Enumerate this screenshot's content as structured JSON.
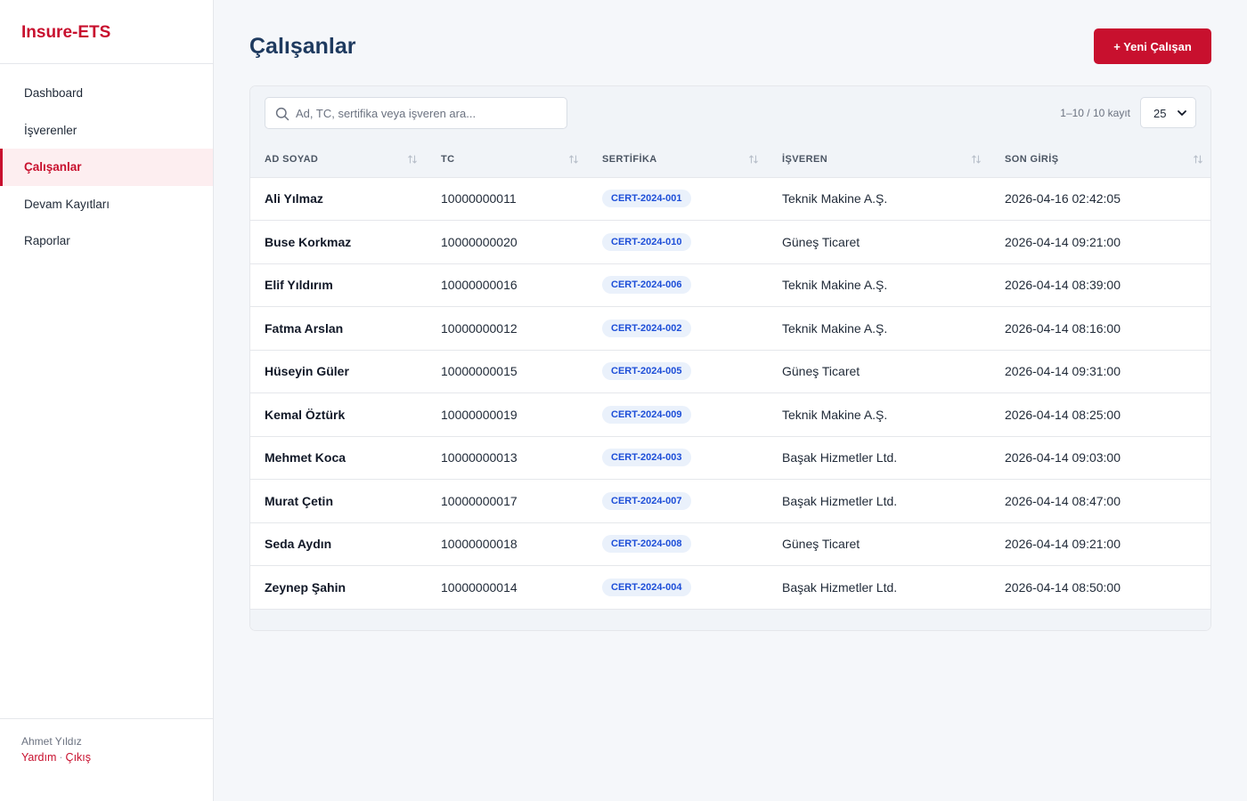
{
  "brand": "Insure-ETS",
  "nav": [
    {
      "label": "Dashboard"
    },
    {
      "label": "İşverenler"
    },
    {
      "label": "Çalışanlar"
    },
    {
      "label": "Devam Kayıtları"
    },
    {
      "label": "Raporlar"
    }
  ],
  "active_nav": "Çalışanlar",
  "footer": {
    "user": "Ahmet Yıldız",
    "help": "Yardım",
    "separator": "·",
    "logout": "Çıkış"
  },
  "page": {
    "title": "Çalışanlar",
    "new_button": "+ Yeni Çalışan"
  },
  "search": {
    "placeholder": "Ad, TC, sertifika veya işveren ara...",
    "value": ""
  },
  "pagination": {
    "summary": "1–10 / 10 kayıt",
    "page_size": "25"
  },
  "table": {
    "columns": [
      "AD SOYAD",
      "TC",
      "SERTİFİKA",
      "İŞVEREN",
      "SON GİRİŞ"
    ],
    "rows": [
      {
        "name": "Ali Yılmaz",
        "tc": "10000000011",
        "cert": "CERT-2024-001",
        "employer": "Teknik Makine A.Ş.",
        "last_login": "2026-04-16 02:42:05"
      },
      {
        "name": "Buse Korkmaz",
        "tc": "10000000020",
        "cert": "CERT-2024-010",
        "employer": "Güneş Ticaret",
        "last_login": "2026-04-14 09:21:00"
      },
      {
        "name": "Elif Yıldırım",
        "tc": "10000000016",
        "cert": "CERT-2024-006",
        "employer": "Teknik Makine A.Ş.",
        "last_login": "2026-04-14 08:39:00"
      },
      {
        "name": "Fatma Arslan",
        "tc": "10000000012",
        "cert": "CERT-2024-002",
        "employer": "Teknik Makine A.Ş.",
        "last_login": "2026-04-14 08:16:00"
      },
      {
        "name": "Hüseyin Güler",
        "tc": "10000000015",
        "cert": "CERT-2024-005",
        "employer": "Güneş Ticaret",
        "last_login": "2026-04-14 09:31:00"
      },
      {
        "name": "Kemal Öztürk",
        "tc": "10000000019",
        "cert": "CERT-2024-009",
        "employer": "Teknik Makine A.Ş.",
        "last_login": "2026-04-14 08:25:00"
      },
      {
        "name": "Mehmet Koca",
        "tc": "10000000013",
        "cert": "CERT-2024-003",
        "employer": "Başak Hizmetler Ltd.",
        "last_login": "2026-04-14 09:03:00"
      },
      {
        "name": "Murat Çetin",
        "tc": "10000000017",
        "cert": "CERT-2024-007",
        "employer": "Başak Hizmetler Ltd.",
        "last_login": "2026-04-14 08:47:00"
      },
      {
        "name": "Seda Aydın",
        "tc": "10000000018",
        "cert": "CERT-2024-008",
        "employer": "Güneş Ticaret",
        "last_login": "2026-04-14 09:21:00"
      },
      {
        "name": "Zeynep Şahin",
        "tc": "10000000014",
        "cert": "CERT-2024-004",
        "employer": "Başak Hizmetler Ltd.",
        "last_login": "2026-04-14 08:50:00"
      }
    ]
  },
  "icons": {
    "search": "search-icon",
    "sort": "sort-arrows-icon",
    "dropdown": "chevron-down-icon"
  },
  "colors": {
    "accent": "#c8102e",
    "title": "#1e3a5f",
    "badge_text": "#1d4ed8",
    "badge_bg": "#eaf1fb"
  }
}
